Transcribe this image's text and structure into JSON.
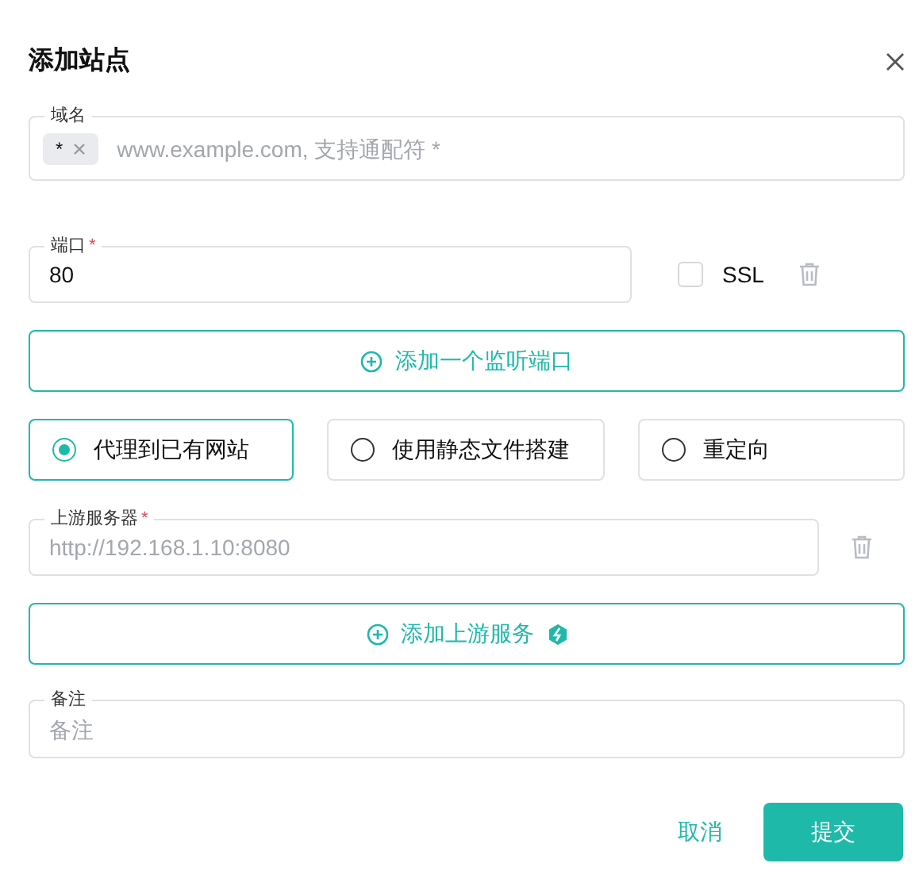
{
  "dialog": {
    "title": "添加站点",
    "domain": {
      "label": "域名",
      "tags": [
        {
          "text": "*"
        }
      ],
      "placeholder": "www.example.com, 支持通配符 *"
    },
    "port": {
      "label": "端口",
      "required_mark": "*",
      "value": "80",
      "ssl": {
        "label": "SSL",
        "checked": false
      }
    },
    "add_port_button": "添加一个监听端口",
    "modes": [
      {
        "label": "代理到已有网站",
        "selected": true
      },
      {
        "label": "使用静态文件搭建",
        "selected": false
      },
      {
        "label": "重定向",
        "selected": false
      }
    ],
    "upstream": {
      "label": "上游服务器",
      "required_mark": "*",
      "placeholder": "http://192.168.1.10:8080"
    },
    "add_upstream_button": "添加上游服务",
    "remark": {
      "label": "备注",
      "placeholder": "备注"
    },
    "buttons": [
      {
        "label": "取消",
        "kind": "text"
      },
      {
        "label": "提交",
        "kind": "primary"
      }
    ]
  }
}
